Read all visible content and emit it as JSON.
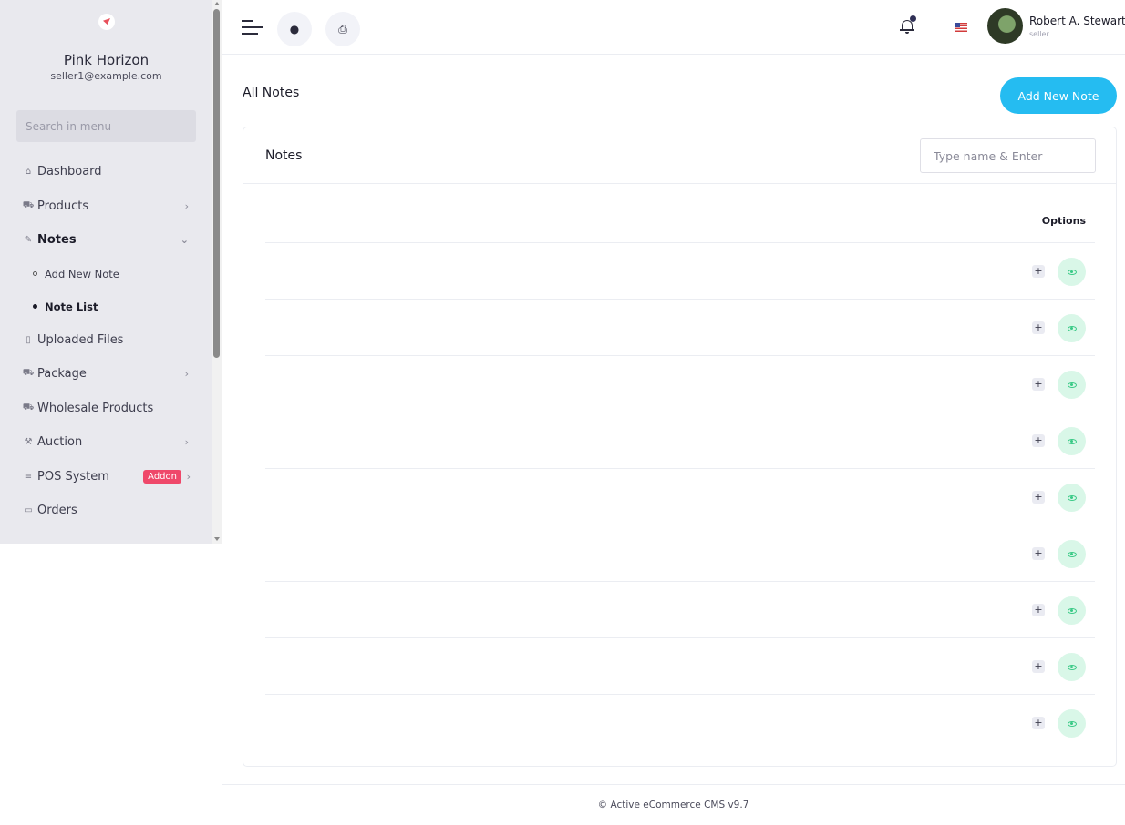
{
  "sidebar": {
    "shop_name": "Pink Horizon",
    "shop_email": "seller1@example.com",
    "search_placeholder": "Search in menu",
    "items": [
      {
        "label": "Dashboard",
        "icon": "home-icon"
      },
      {
        "label": "Products",
        "icon": "cart-icon"
      },
      {
        "label": "Notes",
        "icon": "note-icon"
      },
      {
        "label": "Uploaded Files",
        "icon": "folder-icon"
      },
      {
        "label": "Package",
        "icon": "cart-icon"
      },
      {
        "label": "Wholesale Products",
        "icon": "basket-icon"
      },
      {
        "label": "Auction",
        "icon": "gavel-icon"
      },
      {
        "label": "POS System",
        "icon": "list-icon",
        "badge": "Addon"
      },
      {
        "label": "Orders",
        "icon": "money-icon"
      }
    ],
    "notes_sub": [
      {
        "label": "Add New Note"
      },
      {
        "label": "Note List"
      }
    ]
  },
  "topbar": {
    "user_name": "Robert A. Stewart",
    "user_role": "seller",
    "language_flag": "us-flag-icon"
  },
  "main": {
    "page_title": "All Notes",
    "add_button": "Add New Note",
    "card_title": "Notes",
    "search_placeholder": "Type name & Enter",
    "column_options": "Options",
    "row_count": 9
  },
  "footer": {
    "text": "© Active eCommerce CMS v9.7"
  },
  "colors": {
    "accent": "#25bcf1",
    "addon_badge": "#ef486a",
    "view_button_bg": "#d9f7e8",
    "view_icon": "#38c985",
    "sidebar_bg": "#e9e9ee"
  }
}
